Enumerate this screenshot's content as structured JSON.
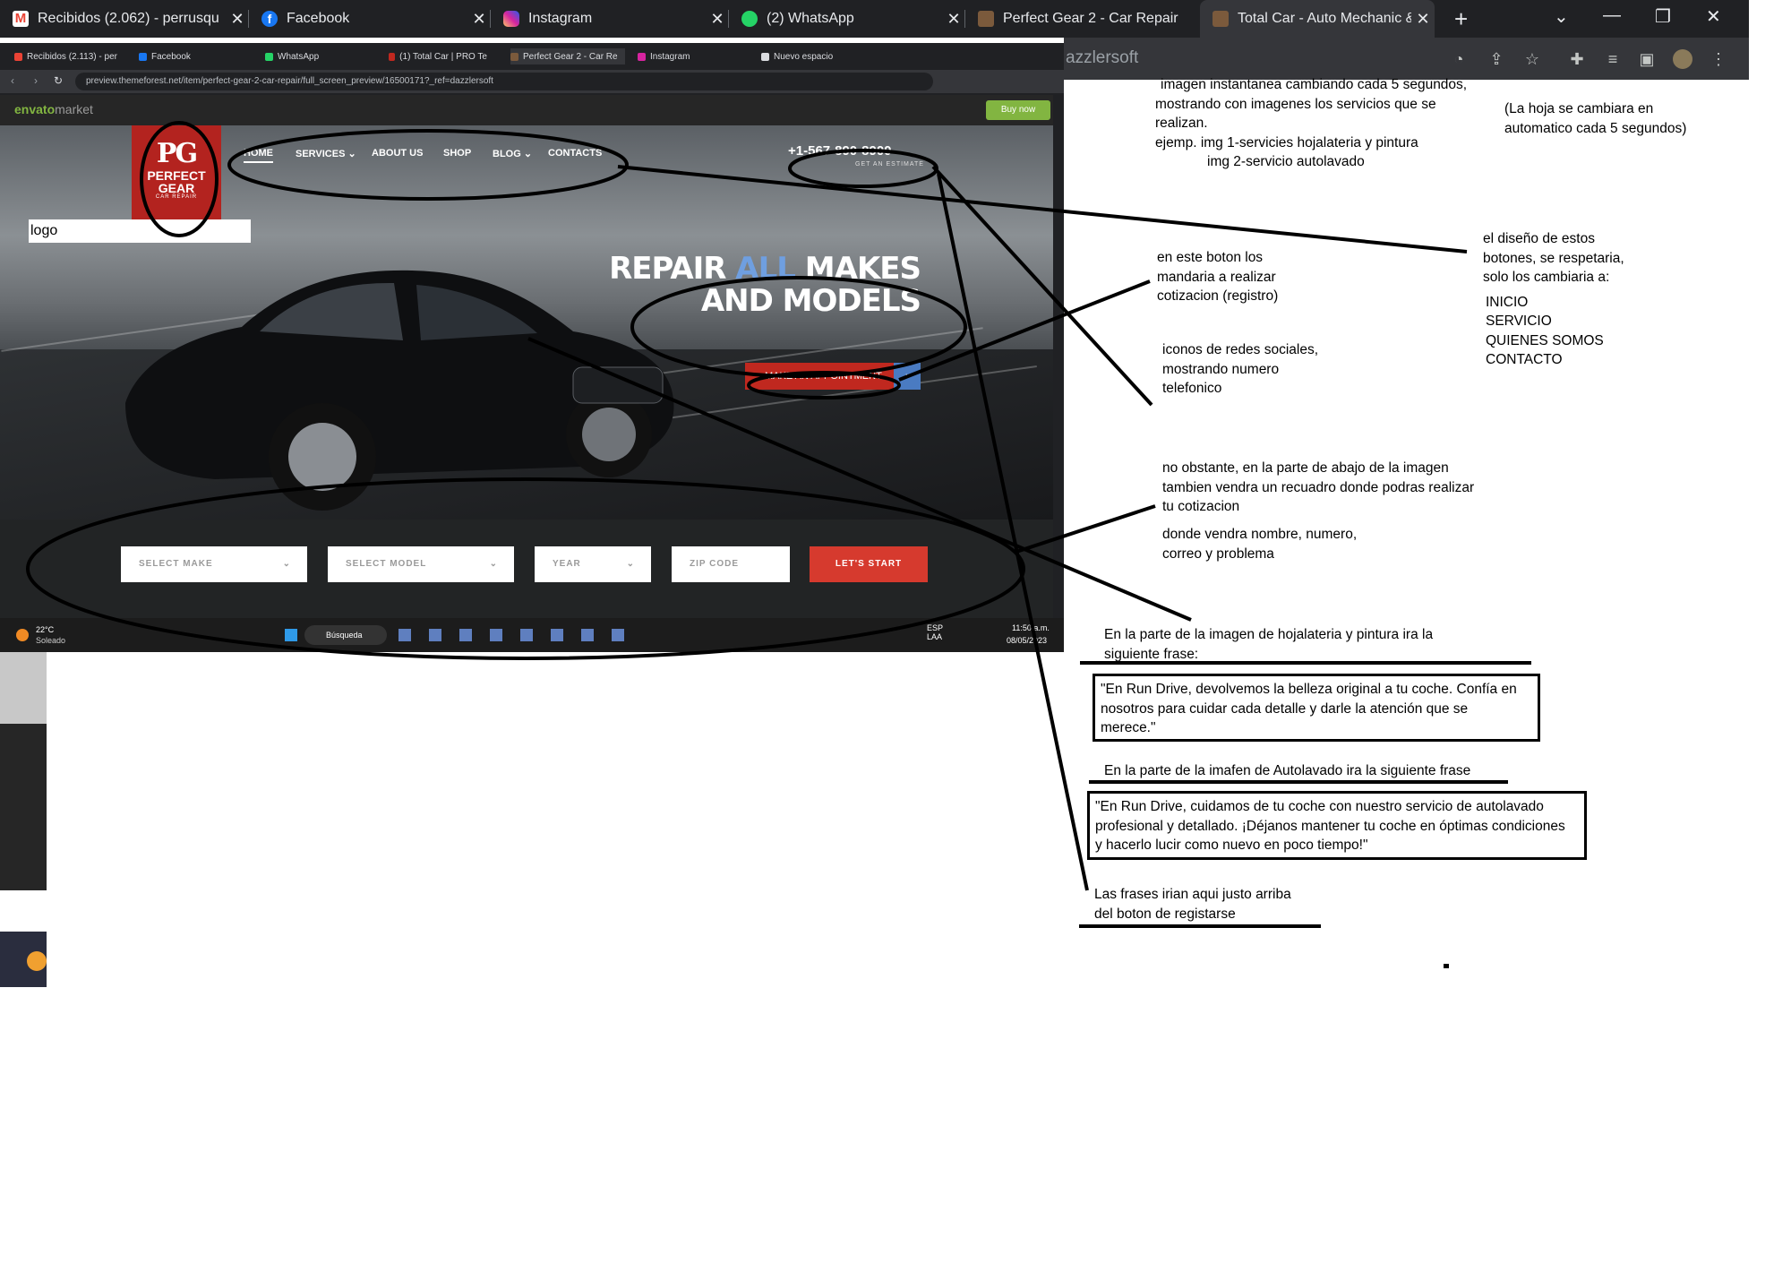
{
  "browser": {
    "tabs": [
      {
        "title": "Recibidos (2.062) - perrusqu",
        "icon": "gmail-icon",
        "color": "#ea4335"
      },
      {
        "title": "Facebook",
        "icon": "facebook-icon",
        "color": "#1877f2"
      },
      {
        "title": "Instagram",
        "icon": "instagram-icon",
        "color": "#d6249f"
      },
      {
        "title": "(2) WhatsApp",
        "icon": "whatsapp-icon",
        "color": "#25d366"
      },
      {
        "title": "Perfect Gear 2 - Car Repair",
        "icon": "site-icon",
        "color": "#7b5a3c"
      },
      {
        "title": "Total Car - Auto Mechanic &",
        "icon": "site-icon",
        "color": "#7b5a3c"
      }
    ],
    "new_tab": "+",
    "address_fragment": "azzlersoft"
  },
  "screenshot": {
    "tabs": [
      "Recibidos (2.113) - per",
      "Facebook",
      "WhatsApp",
      "(1) Total Car | PRO Te",
      "Perfect Gear 2 - Car Re",
      "Instagram",
      "Nuevo espacio"
    ],
    "url": "preview.themeforest.net/item/perfect-gear-2-car-repair/full_screen_preview/16500171?_ref=dazzlersoft",
    "envato": {
      "brand": "envato",
      "brand_suffix": "market",
      "buy": "Buy now"
    },
    "logo": {
      "mark": "PG",
      "line1": "PERFECT",
      "line2": "GEAR",
      "tag": "CAR REPAIR"
    },
    "nav": [
      {
        "label": "HOME"
      },
      {
        "label": "SERVICES ⌄"
      },
      {
        "label": "ABOUT US"
      },
      {
        "label": "SHOP"
      },
      {
        "label": "BLOG ⌄"
      },
      {
        "label": "CONTACTS"
      }
    ],
    "phone": "+1-567-890-8900",
    "phone_sub": "GET AN ESTIMATE",
    "headline_part1": "REPAIR ",
    "headline_highlight": "ALL",
    "headline_part2": " MAKES",
    "headline_line2": "AND MODELS",
    "cta": "MAKE AN APPOINTMENT",
    "logo_label": "logo",
    "form": {
      "make": "SELECT MAKE",
      "model": "SELECT MODEL",
      "year": "YEAR",
      "zip": "ZIP CODE",
      "button": "LET'S START"
    },
    "taskbar": {
      "weather_temp": "22°C",
      "weather_text": "Soleado",
      "search": "Búsqueda",
      "lang": "ESP\nLAA",
      "time": "11:50 a.m.",
      "date": "08/05/2023"
    }
  },
  "annotations": {
    "n1_lines": [
      "imagen instantanea cambiando cada 5 segundos,",
      "mostrando con imagenes los servicios que se",
      "realizan.",
      "ejemp. img 1-servicies hojalateria y pintura",
      "img 2-servicio autolavado"
    ],
    "n2_lines": [
      "(La hoja se cambiara en",
      "automatico cada 5 segundos)"
    ],
    "n3_lines": [
      "el diseño de estos",
      "botones, se respetaria,",
      "solo los cambiaria a:"
    ],
    "n3_items": [
      "INICIO",
      "SERVICIO",
      "QUIENES SOMOS",
      "CONTACTO"
    ],
    "n4_lines": [
      "en este boton los",
      "mandaria a realizar",
      "cotizacion (registro)"
    ],
    "n5_lines": [
      "iconos de redes sociales,",
      "mostrando numero",
      "telefonico"
    ],
    "n6_lines": [
      "no obstante, en la parte de abajo de la imagen",
      "tambien vendra un recuadro donde podras realizar",
      "tu cotizacion"
    ],
    "n7_lines": [
      "donde vendra nombre, numero,",
      "correo y problema"
    ],
    "n8_lines": [
      "En la parte de la imagen de hojalateria y pintura ira la",
      "siguiente frase:"
    ],
    "quote1_lines": [
      "\"En Run Drive, devolvemos la belleza original a tu coche. Confía en",
      "nosotros para cuidar cada detalle y darle la atención que se",
      "merece.\""
    ],
    "n9": "En la parte de la imafen de Autolavado ira la siguiente frase",
    "quote2_lines": [
      "\"En Run Drive, cuidamos de tu coche con nuestro servicio de autolavado",
      "profesional y detallado. ¡Déjanos mantener tu coche en óptimas condiciones",
      "y hacerlo lucir como nuevo en poco tiempo!\""
    ],
    "n10_lines": [
      "Las frases irian aqui justo arriba",
      "del boton de registarse"
    ]
  }
}
